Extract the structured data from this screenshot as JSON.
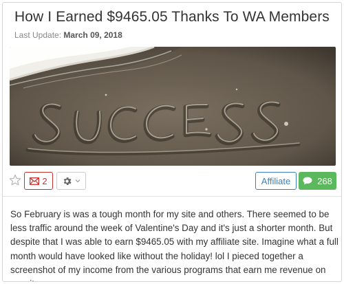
{
  "post": {
    "title": "How I Earned $9465.05 Thanks To WA Members",
    "last_update_label": "Last Update:",
    "last_update_date": "March 09, 2018",
    "hero_image": {
      "written_word": "SUCCESS"
    },
    "body": "So February is was a tough month for my site and others. There seemed to be less traffic around the week of Valentine's Day and it's just a shorter month. But despite that I was able to earn $9465.05 with my affiliate site. Imagine what a full month would have looked like without the holiday! lol I pieced together a screenshot of my income from the various programs that earn me revenue on my site."
  },
  "actions": {
    "star_icon": "star-outline-icon",
    "message_icon": "envelope-icon",
    "message_count": "2",
    "settings_icon": "gear-icon",
    "settings_dropdown_icon": "chevron-down-icon",
    "affiliate_label": "Affiliate",
    "comment_icon": "speech-bubble-icon",
    "comment_count": "268"
  },
  "colors": {
    "message_red": "#c9302c",
    "affiliate_blue": "#3b7fb8",
    "comments_green": "#5cb85c",
    "sand": "#6e6354",
    "foam": "#e9e7e2"
  }
}
